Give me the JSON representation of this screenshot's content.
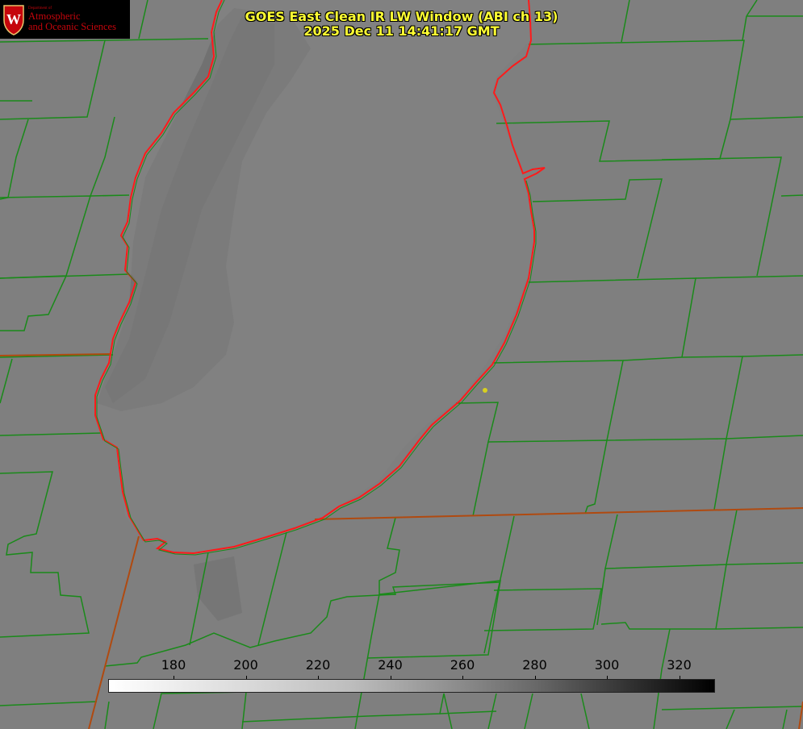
{
  "title": {
    "line1": "GOES East Clean IR LW Window (ABI ch 13)",
    "line2": "2025 Dec 11 14:41:17 GMT"
  },
  "logo": {
    "small_text": "Department of",
    "line1": "Atmospheric",
    "line2": "and Oceanic Sciences",
    "crest_letter": "W",
    "icon": "uw-crest-icon"
  },
  "colorbar": {
    "ticks": [
      "180",
      "200",
      "220",
      "240",
      "260",
      "280",
      "300",
      "320"
    ],
    "palette": [
      "#ffffff",
      "#bdbdbd",
      "#6a6a6a",
      "#000000"
    ]
  },
  "colors": {
    "title": "#ffff33",
    "county_lines": "#1a8a1a",
    "state_lines": "#b04a10",
    "shoreline": "#ff1a1a",
    "background": "#7f7f7f"
  }
}
